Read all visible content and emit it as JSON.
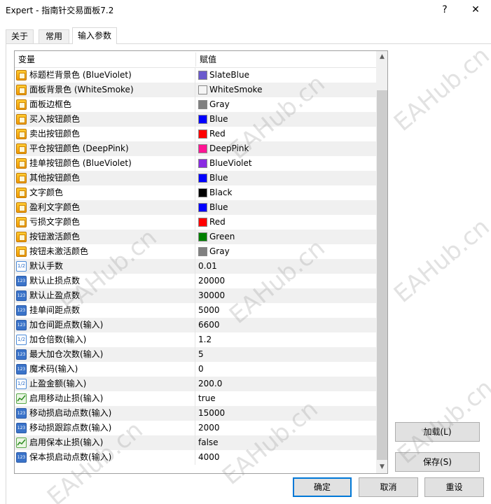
{
  "window": {
    "title": "Expert - 指南针交易面板7.2",
    "help": "?",
    "close": "✕"
  },
  "tabs": [
    {
      "label": "关于"
    },
    {
      "label": "常用"
    },
    {
      "label": "输入参数"
    }
  ],
  "grid": {
    "headers": {
      "variable": "变量",
      "value": "赋值"
    },
    "rows": [
      {
        "name": "标题栏背景色 (BlueViolet)",
        "value": "SlateBlue",
        "type": "color",
        "color": "#6a5acd"
      },
      {
        "name": "面板背景色 (WhiteSmoke)",
        "value": "WhiteSmoke",
        "type": "color",
        "color": "#f5f5f5"
      },
      {
        "name": "面板边框色",
        "value": "Gray",
        "type": "color",
        "color": "#808080"
      },
      {
        "name": "买入按钮颜色",
        "value": "Blue",
        "type": "color",
        "color": "#0000ff"
      },
      {
        "name": "卖出按钮颜色",
        "value": "Red",
        "type": "color",
        "color": "#ff0000"
      },
      {
        "name": "平仓按钮颜色 (DeepPink)",
        "value": "DeepPink",
        "type": "color",
        "color": "#ff1493"
      },
      {
        "name": "挂单按钮颜色 (BlueViolet)",
        "value": "BlueViolet",
        "type": "color",
        "color": "#8a2be2"
      },
      {
        "name": "其他按钮颜色",
        "value": "Blue",
        "type": "color",
        "color": "#0000ff"
      },
      {
        "name": "文字颜色",
        "value": "Black",
        "type": "color",
        "color": "#000000"
      },
      {
        "name": "盈利文字颜色",
        "value": "Blue",
        "type": "color",
        "color": "#0000ff"
      },
      {
        "name": "亏损文字颜色",
        "value": "Red",
        "type": "color",
        "color": "#ff0000"
      },
      {
        "name": "按钮激活颜色",
        "value": "Green",
        "type": "color",
        "color": "#008000"
      },
      {
        "name": "按钮未激活颜色",
        "value": "Gray",
        "type": "color",
        "color": "#808080"
      },
      {
        "name": "默认手数",
        "value": "0.01",
        "type": "double"
      },
      {
        "name": "默认止损点数",
        "value": "20000",
        "type": "int"
      },
      {
        "name": "默认止盈点数",
        "value": "30000",
        "type": "int"
      },
      {
        "name": "挂单间距点数",
        "value": "5000",
        "type": "int"
      },
      {
        "name": "加仓间距点数(输入)",
        "value": "6600",
        "type": "int"
      },
      {
        "name": "加仓倍数(输入)",
        "value": "1.2",
        "type": "double"
      },
      {
        "name": "最大加仓次数(输入)",
        "value": "5",
        "type": "int"
      },
      {
        "name": "魔术码(输入)",
        "value": "0",
        "type": "int"
      },
      {
        "name": "止盈金额(输入)",
        "value": "200.0",
        "type": "double"
      },
      {
        "name": "启用移动止损(输入)",
        "value": "true",
        "type": "bool"
      },
      {
        "name": "移动损启动点数(输入)",
        "value": "15000",
        "type": "int"
      },
      {
        "name": "移动损跟踪点数(输入)",
        "value": "2000",
        "type": "int"
      },
      {
        "name": "启用保本止损(输入)",
        "value": "false",
        "type": "bool"
      },
      {
        "name": "保本损启动点数(输入)",
        "value": "4000",
        "type": "int"
      }
    ]
  },
  "icons": {
    "int": "123",
    "double": "1/2",
    "color": "color-icon",
    "bool": "bool-icon"
  },
  "buttons": {
    "load": "加载(L)",
    "save": "保存(S)",
    "ok": "确定",
    "cancel": "取消",
    "reset": "重设"
  },
  "watermark": "EAHub.cn"
}
